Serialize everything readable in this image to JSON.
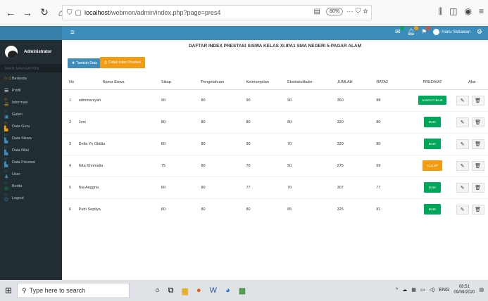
{
  "browser": {
    "url_host": "localhost",
    "url_path": "/webmon/admin/index.php?page=pres4",
    "zoom": "80%"
  },
  "sidebar": {
    "user_name": "Administrator",
    "section_label": "MAIN NAVIGATION",
    "items": [
      {
        "label": "Beranda",
        "icon": "home-icon"
      },
      {
        "label": "Profil",
        "icon": "list-icon"
      },
      {
        "label": "Informasi",
        "icon": "list-icon"
      },
      {
        "label": "Galeri",
        "icon": "image-icon"
      },
      {
        "label": "Data Guru",
        "icon": "file-icon"
      },
      {
        "label": "Data Siswa",
        "icon": "file-icon"
      },
      {
        "label": "Data Nilai",
        "icon": "file-icon"
      },
      {
        "label": "Data Prestasi",
        "icon": "file-icon"
      },
      {
        "label": "User",
        "icon": "user-icon"
      },
      {
        "label": "Berita",
        "icon": "circle-icon"
      },
      {
        "label": "Logout",
        "icon": "power-icon"
      }
    ]
  },
  "topbar": {
    "user_label": "Hanu Setiawan"
  },
  "main": {
    "title": "DAFTAR INDEX PRESTASI SISWA KELAS XI.IPA1 SMA NEGERI 5 PAGAR ALAM",
    "add_button": "Tambah Data",
    "print_button": "Cetak Index Prestasi",
    "columns": [
      "No",
      "Nama Siswa",
      "Sikap",
      "Pengetahuan",
      "Keterampilan",
      "Ekstrakulikuler",
      "JUMLAH",
      "RATA2",
      "PREDIKAT",
      "Aksi"
    ],
    "rows": [
      {
        "no": "1",
        "nama": "adminarsyah",
        "sikap": "90",
        "peng": "80",
        "ket": "90",
        "eks": "90",
        "jml": "350",
        "rata": "88",
        "pred": "SANGAT BAIK",
        "pred_type": "sangat"
      },
      {
        "no": "2",
        "nama": "Jeni",
        "sikap": "80",
        "peng": "80",
        "ket": "80",
        "eks": "80",
        "jml": "320",
        "rata": "80",
        "pred": "BAIK",
        "pred_type": "baik"
      },
      {
        "no": "3",
        "nama": "Della Yn Oktilia",
        "sikap": "80",
        "peng": "80",
        "ket": "90",
        "eks": "70",
        "jml": "320",
        "rata": "80",
        "pred": "BAIK",
        "pred_type": "baik"
      },
      {
        "no": "4",
        "nama": "Gita Khomalia",
        "sikap": "75",
        "peng": "80",
        "ket": "70",
        "eks": "50",
        "jml": "275",
        "rata": "69",
        "pred": "CUKUP",
        "pred_type": "cukup"
      },
      {
        "no": "5",
        "nama": "Nia Anggria",
        "sikap": "80",
        "peng": "80",
        "ket": "77",
        "eks": "70",
        "jml": "307",
        "rata": "77",
        "pred": "BAIK",
        "pred_type": "baik"
      },
      {
        "no": "6",
        "nama": "Putri Septiya",
        "sikap": "80",
        "peng": "80",
        "ket": "80",
        "eks": "85",
        "jml": "325",
        "rata": "81",
        "pred": "BAIK",
        "pred_type": "baik"
      }
    ]
  },
  "taskbar": {
    "search_placeholder": "Type here to search",
    "lang": "ENG",
    "time": "08:51",
    "date": "09/09/2020"
  }
}
